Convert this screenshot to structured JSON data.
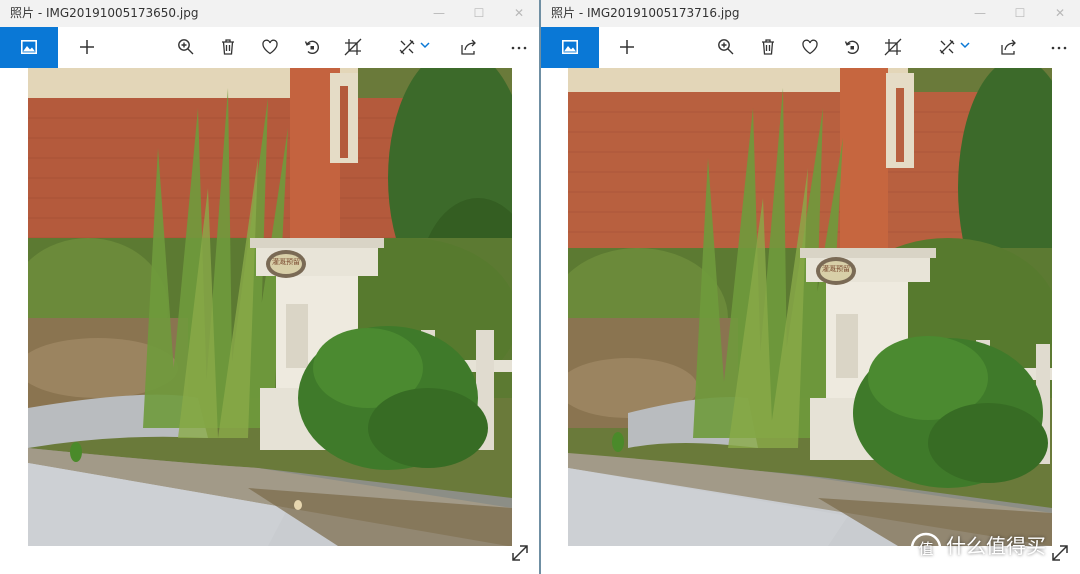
{
  "windows": [
    {
      "app_name": "照片",
      "separator": " - ",
      "file_name": "IMG20191005173650.jpg",
      "toolbar": {
        "items": [
          "gallery-icon",
          "add-icon",
          "zoom-in-icon",
          "delete-icon",
          "favorite-icon",
          "rotate-icon",
          "crop-icon",
          "edit-icon",
          "share-icon",
          "more-icon"
        ]
      }
    },
    {
      "app_name": "照片",
      "separator": " - ",
      "file_name": "IMG20191005173716.jpg",
      "toolbar": {
        "items": [
          "gallery-icon",
          "add-icon",
          "zoom-in-icon",
          "delete-icon",
          "favorite-icon",
          "rotate-icon",
          "crop-icon",
          "edit-icon",
          "share-icon",
          "more-icon"
        ]
      }
    }
  ],
  "photo_sign_text": "灌溉预留",
  "watermark": {
    "text": "什么值得买",
    "logo": "值"
  },
  "colors": {
    "accent": "#0a78d6",
    "brick": "#b45a3c",
    "grass": "#6b8a3a",
    "shrub": "#3f7a2a",
    "pavement": "#c9ccd0"
  }
}
